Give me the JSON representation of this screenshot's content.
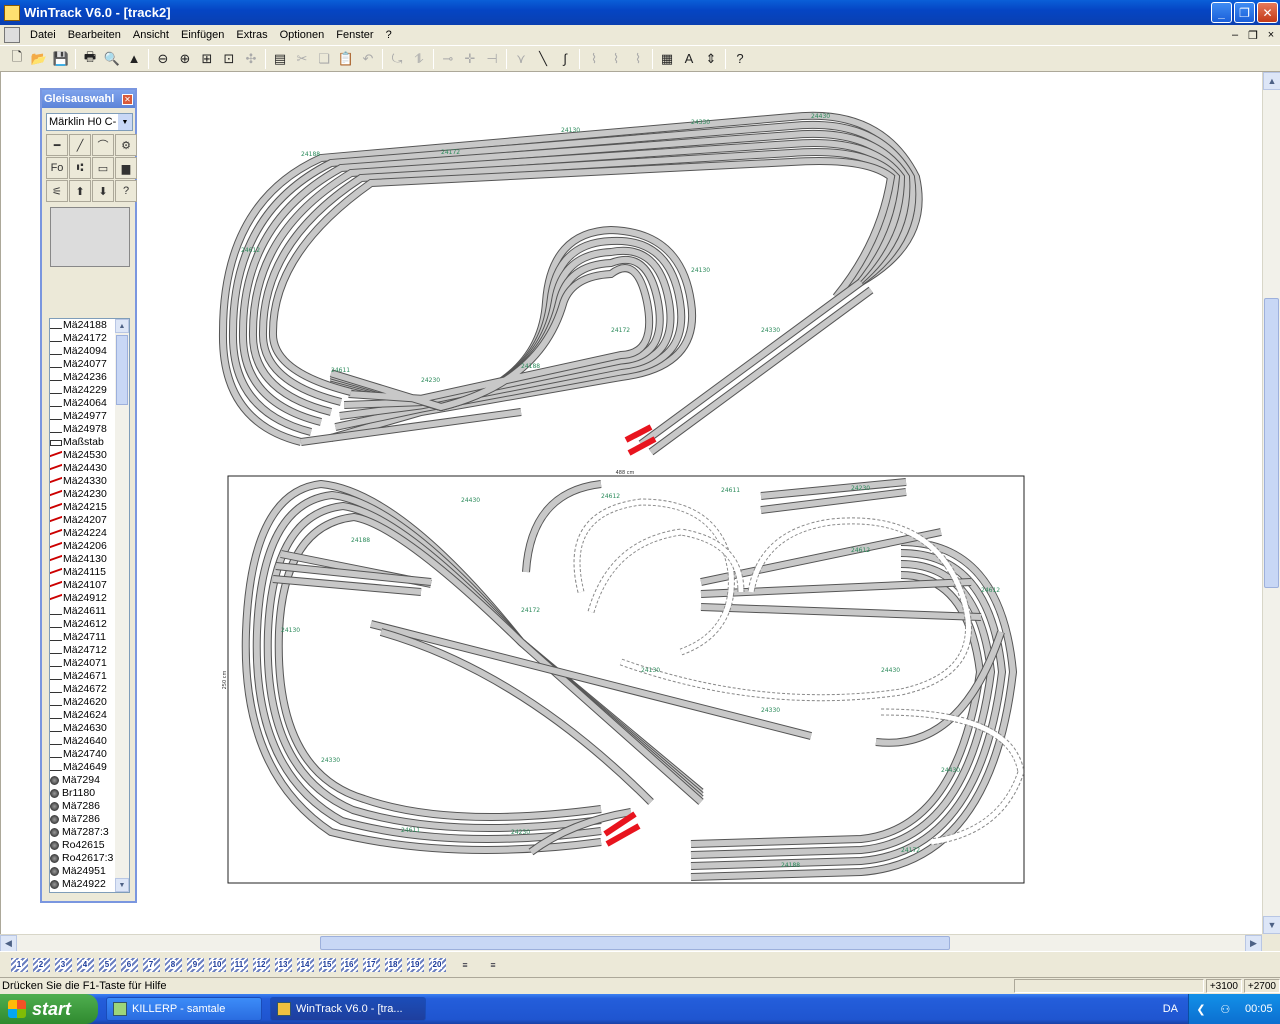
{
  "window": {
    "title": "WinTrack  V6.0 - [track2]",
    "buttons": [
      "_",
      "❐",
      "✕"
    ]
  },
  "menu": {
    "items": [
      "Datei",
      "Bearbeiten",
      "Ansicht",
      "Einfügen",
      "Extras",
      "Optionen",
      "Fenster",
      "?"
    ],
    "mdi_buttons": [
      "–",
      "❐",
      "×"
    ]
  },
  "toolbar": {
    "buttons": [
      {
        "icon": "new-icon",
        "glyph": "🗋",
        "enabled": true
      },
      {
        "icon": "open-icon",
        "glyph": "📂",
        "enabled": true
      },
      {
        "icon": "save-icon",
        "glyph": "💾",
        "enabled": true
      },
      {
        "sep": true
      },
      {
        "icon": "print-icon",
        "glyph": "🖶",
        "enabled": true
      },
      {
        "icon": "print-preview-icon",
        "glyph": "🔍",
        "enabled": true
      },
      {
        "icon": "3d-view-icon",
        "glyph": "▲",
        "enabled": true
      },
      {
        "sep": true
      },
      {
        "icon": "zoom-out-icon",
        "glyph": "⊖",
        "enabled": true
      },
      {
        "icon": "zoom-in-icon",
        "glyph": "⊕",
        "enabled": true
      },
      {
        "icon": "zoom-window-icon",
        "glyph": "⊞",
        "enabled": true
      },
      {
        "icon": "zoom-all-icon",
        "glyph": "⊡",
        "enabled": true
      },
      {
        "icon": "zoom-fit-icon",
        "glyph": "✣",
        "enabled": false
      },
      {
        "sep": true
      },
      {
        "icon": "delete-icon",
        "glyph": "▤",
        "enabled": true
      },
      {
        "icon": "cut-icon",
        "glyph": "✂",
        "enabled": false
      },
      {
        "icon": "copy-icon",
        "glyph": "❏",
        "enabled": false
      },
      {
        "icon": "paste-icon",
        "glyph": "📋",
        "enabled": false
      },
      {
        "icon": "undo-icon",
        "glyph": "↶",
        "enabled": false
      },
      {
        "sep": true
      },
      {
        "icon": "rotate-icon",
        "glyph": "⤿",
        "enabled": false
      },
      {
        "icon": "mirror-icon",
        "glyph": "⥮",
        "enabled": false
      },
      {
        "sep": true
      },
      {
        "icon": "connect-icon",
        "glyph": "⊸",
        "enabled": false
      },
      {
        "icon": "align-icon",
        "glyph": "✛",
        "enabled": false
      },
      {
        "icon": "split-icon",
        "glyph": "⊣",
        "enabled": false
      },
      {
        "sep": true
      },
      {
        "icon": "flex-straight-icon",
        "glyph": "⋎",
        "enabled": false
      },
      {
        "icon": "flex-curve-icon",
        "glyph": "╲",
        "enabled": true
      },
      {
        "icon": "flex-bend-icon",
        "glyph": "∫",
        "enabled": true
      },
      {
        "sep": true
      },
      {
        "icon": "flex-a-icon",
        "glyph": "⌇",
        "enabled": false
      },
      {
        "icon": "flex-b-icon",
        "glyph": "⌇",
        "enabled": false
      },
      {
        "icon": "flex-c-icon",
        "glyph": "⌇",
        "enabled": false
      },
      {
        "sep": true
      },
      {
        "icon": "object-icon",
        "glyph": "▦",
        "enabled": true
      },
      {
        "icon": "text-icon",
        "glyph": "A",
        "enabled": true
      },
      {
        "icon": "height-icon",
        "glyph": "⇕",
        "enabled": true
      },
      {
        "sep": true
      },
      {
        "icon": "context-help-icon",
        "glyph": "?",
        "enabled": true
      }
    ]
  },
  "panel": {
    "title": "Gleisauswahl",
    "system": "Märklin H0 C-",
    "tools": [
      "━",
      "╱",
      "⌒",
      "⚙",
      "Fo",
      "⑆",
      "▭",
      "▆",
      "⚟",
      "⬆",
      "⬇",
      "?"
    ],
    "items": [
      {
        "t": "st",
        "label": "Mä24188"
      },
      {
        "t": "st",
        "label": "Mä24172"
      },
      {
        "t": "st",
        "label": "Mä24094"
      },
      {
        "t": "st",
        "label": "Mä24077"
      },
      {
        "t": "st",
        "label": "Mä24236"
      },
      {
        "t": "st",
        "label": "Mä24229"
      },
      {
        "t": "st",
        "label": "Mä24064"
      },
      {
        "t": "st",
        "label": "Mä24977"
      },
      {
        "t": "st",
        "label": "Mä24978"
      },
      {
        "t": "me",
        "label": "Maßstab"
      },
      {
        "t": "cu",
        "label": "Mä24530"
      },
      {
        "t": "cu",
        "label": "Mä24430"
      },
      {
        "t": "cu",
        "label": "Mä24330"
      },
      {
        "t": "cu",
        "label": "Mä24230"
      },
      {
        "t": "cu",
        "label": "Mä24215"
      },
      {
        "t": "cu",
        "label": "Mä24207"
      },
      {
        "t": "cu",
        "label": "Mä24224"
      },
      {
        "t": "cu",
        "label": "Mä24206"
      },
      {
        "t": "cu",
        "label": "Mä24130"
      },
      {
        "t": "cu",
        "label": "Mä24115"
      },
      {
        "t": "cu",
        "label": "Mä24107"
      },
      {
        "t": "cu",
        "label": "Mä24912"
      },
      {
        "t": "st",
        "label": "Mä24611"
      },
      {
        "t": "st",
        "label": "Mä24612"
      },
      {
        "t": "st",
        "label": "Mä24711"
      },
      {
        "t": "st",
        "label": "Mä24712"
      },
      {
        "t": "st",
        "label": "Mä24071"
      },
      {
        "t": "st",
        "label": "Mä24671"
      },
      {
        "t": "st",
        "label": "Mä24672"
      },
      {
        "t": "st",
        "label": "Mä24620"
      },
      {
        "t": "st",
        "label": "Mä24624"
      },
      {
        "t": "st",
        "label": "Mä24630"
      },
      {
        "t": "st",
        "label": "Mä24640"
      },
      {
        "t": "st",
        "label": "Mä24740"
      },
      {
        "t": "st",
        "label": "Mä24649"
      },
      {
        "t": "hs",
        "label": "Mä7294"
      },
      {
        "t": "hs",
        "label": "Br1180"
      },
      {
        "t": "hs",
        "label": "Mä7286"
      },
      {
        "t": "hs",
        "label": "Mä7286"
      },
      {
        "t": "hs",
        "label": "Mä7287:3"
      },
      {
        "t": "hs",
        "label": "Ro42615"
      },
      {
        "t": "hs",
        "label": "Ro42617:3"
      },
      {
        "t": "hs",
        "label": "Mä24951"
      },
      {
        "t": "hs",
        "label": "Mä24922"
      }
    ]
  },
  "canvas": {
    "track_labels": [
      "24188",
      "24172",
      "24130",
      "24330",
      "24430",
      "24612",
      "24611",
      "24230"
    ],
    "board_width_label": "488 cm",
    "board_height_label": "250 cm",
    "track_color": "#c8c8c8",
    "bumper_color": "#e8141e",
    "label_color": "#2a8a5a"
  },
  "layers": [
    "1",
    "2",
    "3",
    "4",
    "5",
    "6",
    "7",
    "8",
    "9",
    "10",
    "11",
    "12",
    "13",
    "14",
    "15",
    "16",
    "17",
    "18",
    "19",
    "20"
  ],
  "status": {
    "message": "Drücken Sie die  F1-Taste für Hilfe",
    "x": "+3100",
    "y": "+2700"
  },
  "taskbar": {
    "start": "start",
    "tasks": [
      {
        "label": "KILLERP - samtale",
        "active": false
      },
      {
        "label": "WinTrack  V6.0 - [tra...",
        "active": true
      }
    ],
    "lang": "DA",
    "clock": "00:05"
  }
}
